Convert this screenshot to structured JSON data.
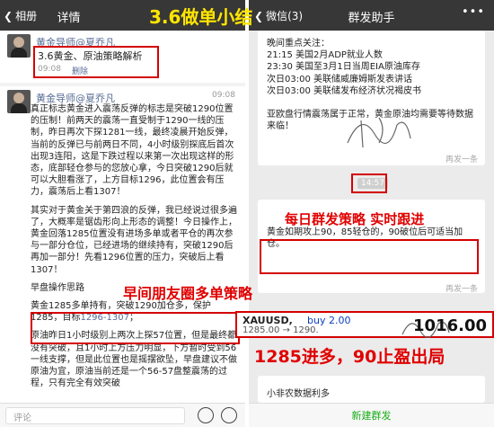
{
  "left": {
    "back_label": "相册",
    "title": "详情",
    "post1": {
      "author": "黄金导师@夏乔凡",
      "title": "3.6黄金、原油策略解析",
      "time": "09:08",
      "delete": "删除"
    },
    "post2": {
      "author": "黄金导师@夏乔凡",
      "time": "09:08",
      "paragraphs": [
        "真正标志黄金进入震荡反弹的标志是突破1290位置的压制！前两天的震荡一直受制于1290一线的压制，昨日再次下探1281一线，最终凌晨开始反弹，当前的反弹已与前两日不同，4小时级别探底后首次出现3连阳，这是下跌过程以来第一次出现这样的形态，底部轻仓参与的您放心拿，今日突破1290后就可以大胆看涨了，上方目标1296，此位置会有压力，震荡后上看1307！",
        "其实对于黄金关于第四浪的反弹，我已经说过很多遍了，大概率是锯齿形向上形态的调整！今日操作上，黄金回落1285位置没有进场多单或者平仓的再次参与一部分仓位，已经进场的继续持有，突破1290后再加一部分！先看1296位置的压力，突破后上看1307！"
      ],
      "subheading": "早盘操作思路",
      "strategy_text": "黄金1285多单持有，突破1290加仓多，保护1285，目标",
      "strategy_link": "1296-1307",
      "strategy_end": "；",
      "tail": "原油昨日1小时级别上两次上探57位置，但是最终都没有突破，且1小时上方压力明显，下方暂时受到56一线支撑，但是此位置也是摇摆欲坠，早盘建议不做原油为宜，原油当前还是一个56-57盘整震荡的过程，只有完全有效突破"
    },
    "comment_placeholder": "评论"
  },
  "right": {
    "back_label": "微信(3)",
    "title": "群发助手",
    "card1_lines": [
      "晚间重点关注：",
      "21:15 美国2月ADP就业人数",
      "23:30 美国至3月1日当周EIA原油库存",
      "次日03:00 美联储威廉姆斯发表讲话",
      "次日03:00 美联储发布经济状况褐皮书",
      "",
      "亚欧盘行情震荡属于正常，黄金原油均需要等待数据来临！"
    ],
    "card1_resend": "再发一条",
    "stamp_time": "14:57",
    "card2_text": "黄金如期攻上90，85轻仓的，90破位后可适当加仓。",
    "card2_resend": "再发一条",
    "quote": {
      "symbol": "XAUUSD,",
      "action": "buy 2.00",
      "line": "1285.00 → 1290.",
      "price": "1016.00"
    },
    "card3_text": "小非农数据利多",
    "new_button": "新建群发"
  },
  "captions": {
    "top": "3.6做单小结",
    "middle_left": "早间朋友圈多单策略",
    "middle_right": "每日群发策略 实时跟进",
    "bottom_right": "1285进多，90止盈出局"
  },
  "colors": {
    "caption_red": "#e00000",
    "caption_yellow": "#ffe600",
    "highlight_border": "#d40000",
    "link": "#576b95",
    "titlebar": "#373737",
    "wechat_green": "#1aad19"
  },
  "icons": [
    "chevron-left-icon",
    "more-icon",
    "quote-icon",
    "emoji-icon",
    "add-icon",
    "signature-icon"
  ]
}
